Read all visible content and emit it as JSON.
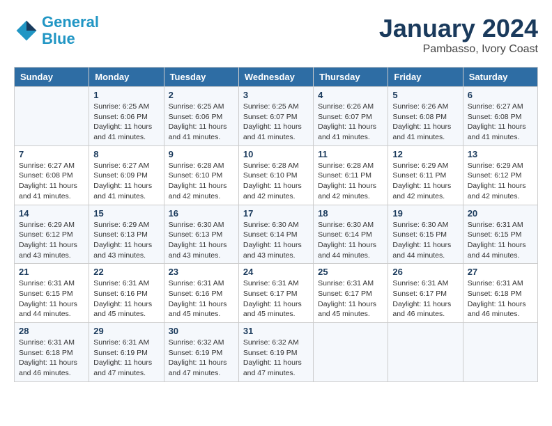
{
  "header": {
    "logo_line1": "General",
    "logo_line2": "Blue",
    "month": "January 2024",
    "location": "Pambasso, Ivory Coast"
  },
  "weekdays": [
    "Sunday",
    "Monday",
    "Tuesday",
    "Wednesday",
    "Thursday",
    "Friday",
    "Saturday"
  ],
  "weeks": [
    [
      {
        "day": "",
        "sunrise": "",
        "sunset": "",
        "daylight": ""
      },
      {
        "day": "1",
        "sunrise": "Sunrise: 6:25 AM",
        "sunset": "Sunset: 6:06 PM",
        "daylight": "Daylight: 11 hours and 41 minutes."
      },
      {
        "day": "2",
        "sunrise": "Sunrise: 6:25 AM",
        "sunset": "Sunset: 6:06 PM",
        "daylight": "Daylight: 11 hours and 41 minutes."
      },
      {
        "day": "3",
        "sunrise": "Sunrise: 6:25 AM",
        "sunset": "Sunset: 6:07 PM",
        "daylight": "Daylight: 11 hours and 41 minutes."
      },
      {
        "day": "4",
        "sunrise": "Sunrise: 6:26 AM",
        "sunset": "Sunset: 6:07 PM",
        "daylight": "Daylight: 11 hours and 41 minutes."
      },
      {
        "day": "5",
        "sunrise": "Sunrise: 6:26 AM",
        "sunset": "Sunset: 6:08 PM",
        "daylight": "Daylight: 11 hours and 41 minutes."
      },
      {
        "day": "6",
        "sunrise": "Sunrise: 6:27 AM",
        "sunset": "Sunset: 6:08 PM",
        "daylight": "Daylight: 11 hours and 41 minutes."
      }
    ],
    [
      {
        "day": "7",
        "sunrise": "Sunrise: 6:27 AM",
        "sunset": "Sunset: 6:08 PM",
        "daylight": "Daylight: 11 hours and 41 minutes."
      },
      {
        "day": "8",
        "sunrise": "Sunrise: 6:27 AM",
        "sunset": "Sunset: 6:09 PM",
        "daylight": "Daylight: 11 hours and 41 minutes."
      },
      {
        "day": "9",
        "sunrise": "Sunrise: 6:28 AM",
        "sunset": "Sunset: 6:10 PM",
        "daylight": "Daylight: 11 hours and 42 minutes."
      },
      {
        "day": "10",
        "sunrise": "Sunrise: 6:28 AM",
        "sunset": "Sunset: 6:10 PM",
        "daylight": "Daylight: 11 hours and 42 minutes."
      },
      {
        "day": "11",
        "sunrise": "Sunrise: 6:28 AM",
        "sunset": "Sunset: 6:11 PM",
        "daylight": "Daylight: 11 hours and 42 minutes."
      },
      {
        "day": "12",
        "sunrise": "Sunrise: 6:29 AM",
        "sunset": "Sunset: 6:11 PM",
        "daylight": "Daylight: 11 hours and 42 minutes."
      },
      {
        "day": "13",
        "sunrise": "Sunrise: 6:29 AM",
        "sunset": "Sunset: 6:12 PM",
        "daylight": "Daylight: 11 hours and 42 minutes."
      }
    ],
    [
      {
        "day": "14",
        "sunrise": "Sunrise: 6:29 AM",
        "sunset": "Sunset: 6:12 PM",
        "daylight": "Daylight: 11 hours and 43 minutes."
      },
      {
        "day": "15",
        "sunrise": "Sunrise: 6:29 AM",
        "sunset": "Sunset: 6:13 PM",
        "daylight": "Daylight: 11 hours and 43 minutes."
      },
      {
        "day": "16",
        "sunrise": "Sunrise: 6:30 AM",
        "sunset": "Sunset: 6:13 PM",
        "daylight": "Daylight: 11 hours and 43 minutes."
      },
      {
        "day": "17",
        "sunrise": "Sunrise: 6:30 AM",
        "sunset": "Sunset: 6:14 PM",
        "daylight": "Daylight: 11 hours and 43 minutes."
      },
      {
        "day": "18",
        "sunrise": "Sunrise: 6:30 AM",
        "sunset": "Sunset: 6:14 PM",
        "daylight": "Daylight: 11 hours and 44 minutes."
      },
      {
        "day": "19",
        "sunrise": "Sunrise: 6:30 AM",
        "sunset": "Sunset: 6:15 PM",
        "daylight": "Daylight: 11 hours and 44 minutes."
      },
      {
        "day": "20",
        "sunrise": "Sunrise: 6:31 AM",
        "sunset": "Sunset: 6:15 PM",
        "daylight": "Daylight: 11 hours and 44 minutes."
      }
    ],
    [
      {
        "day": "21",
        "sunrise": "Sunrise: 6:31 AM",
        "sunset": "Sunset: 6:15 PM",
        "daylight": "Daylight: 11 hours and 44 minutes."
      },
      {
        "day": "22",
        "sunrise": "Sunrise: 6:31 AM",
        "sunset": "Sunset: 6:16 PM",
        "daylight": "Daylight: 11 hours and 45 minutes."
      },
      {
        "day": "23",
        "sunrise": "Sunrise: 6:31 AM",
        "sunset": "Sunset: 6:16 PM",
        "daylight": "Daylight: 11 hours and 45 minutes."
      },
      {
        "day": "24",
        "sunrise": "Sunrise: 6:31 AM",
        "sunset": "Sunset: 6:17 PM",
        "daylight": "Daylight: 11 hours and 45 minutes."
      },
      {
        "day": "25",
        "sunrise": "Sunrise: 6:31 AM",
        "sunset": "Sunset: 6:17 PM",
        "daylight": "Daylight: 11 hours and 45 minutes."
      },
      {
        "day": "26",
        "sunrise": "Sunrise: 6:31 AM",
        "sunset": "Sunset: 6:17 PM",
        "daylight": "Daylight: 11 hours and 46 minutes."
      },
      {
        "day": "27",
        "sunrise": "Sunrise: 6:31 AM",
        "sunset": "Sunset: 6:18 PM",
        "daylight": "Daylight: 11 hours and 46 minutes."
      }
    ],
    [
      {
        "day": "28",
        "sunrise": "Sunrise: 6:31 AM",
        "sunset": "Sunset: 6:18 PM",
        "daylight": "Daylight: 11 hours and 46 minutes."
      },
      {
        "day": "29",
        "sunrise": "Sunrise: 6:31 AM",
        "sunset": "Sunset: 6:19 PM",
        "daylight": "Daylight: 11 hours and 47 minutes."
      },
      {
        "day": "30",
        "sunrise": "Sunrise: 6:32 AM",
        "sunset": "Sunset: 6:19 PM",
        "daylight": "Daylight: 11 hours and 47 minutes."
      },
      {
        "day": "31",
        "sunrise": "Sunrise: 6:32 AM",
        "sunset": "Sunset: 6:19 PM",
        "daylight": "Daylight: 11 hours and 47 minutes."
      },
      {
        "day": "",
        "sunrise": "",
        "sunset": "",
        "daylight": ""
      },
      {
        "day": "",
        "sunrise": "",
        "sunset": "",
        "daylight": ""
      },
      {
        "day": "",
        "sunrise": "",
        "sunset": "",
        "daylight": ""
      }
    ]
  ]
}
